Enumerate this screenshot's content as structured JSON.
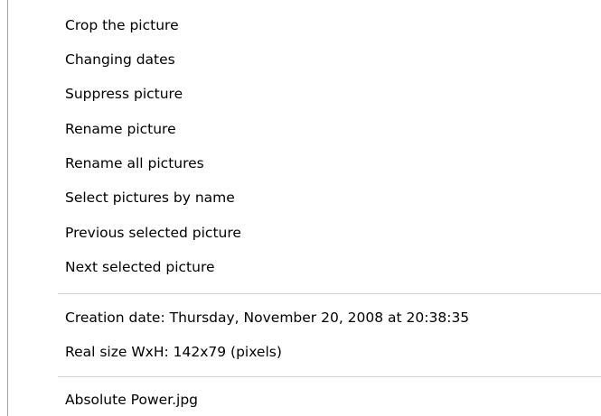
{
  "menu": {
    "actions": [
      "Crop the picture",
      "Changing dates",
      "Suppress picture",
      "Rename picture",
      "Rename all pictures",
      "Select pictures by name",
      "Previous selected picture",
      "Next selected picture"
    ],
    "info": {
      "creation_date": "Creation date: Thursday, November 20, 2008 at 20:38:35",
      "real_size": "Real size WxH: 142x79 (pixels)"
    },
    "file_name": "Absolute Power.jpg"
  }
}
